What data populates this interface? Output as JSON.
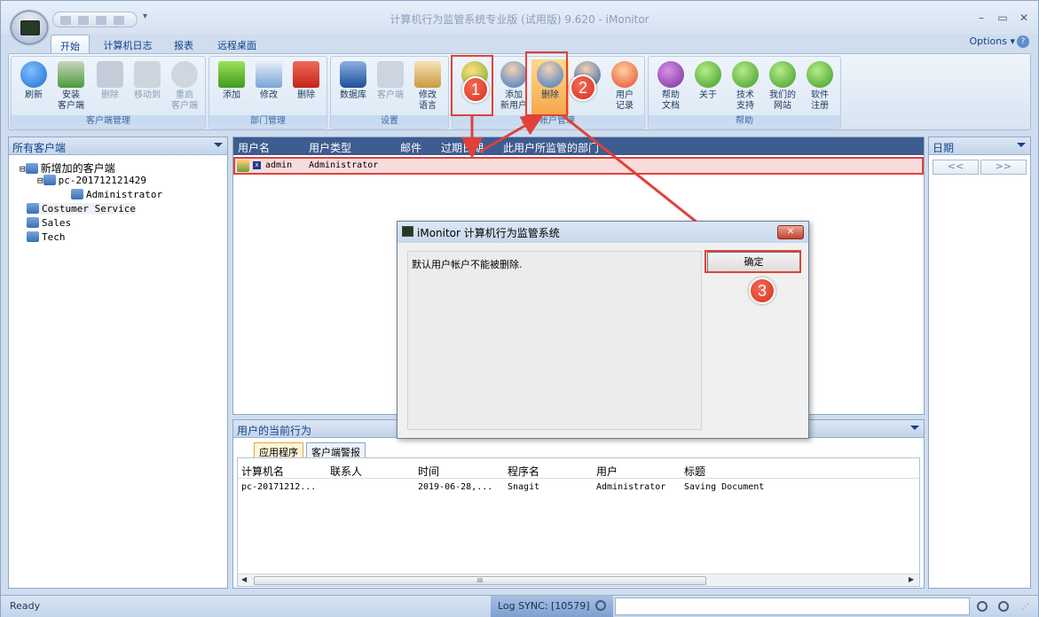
{
  "window": {
    "title": "计算机行为监管系统专业版 (试用版) 9.620 - iMonitor"
  },
  "tabs": [
    "开始",
    "计算机日志",
    "报表",
    "远程桌面"
  ],
  "options_label": "Options",
  "ribbon": {
    "groups": [
      {
        "label": "客户端管理",
        "buttons": [
          "刷新",
          "安装\n客户端",
          "删除",
          "移动到",
          "重启\n客户端"
        ]
      },
      {
        "label": "部门管理",
        "buttons": [
          "添加",
          "修改",
          "删除"
        ]
      },
      {
        "label": "设置",
        "buttons": [
          "数据库",
          "客户端",
          "修改\n语言"
        ]
      },
      {
        "label": "用户帐户管理",
        "buttons": [
          "用户",
          "添加\n新用户",
          "删除",
          "",
          "用户\n记录"
        ]
      },
      {
        "label": "帮助",
        "buttons": [
          "帮助\n文档",
          "关于",
          "技术\n支持",
          "我们的\n网站",
          "软件\n注册"
        ]
      }
    ]
  },
  "left_panel": {
    "title": "所有客户端",
    "tree": [
      "新增加的客户端",
      "pc-201712121429",
      "Administrator",
      "Costumer Service",
      "Sales",
      "Tech"
    ]
  },
  "users_grid": {
    "columns": [
      "用户名",
      "用户类型",
      "邮件",
      "过期日期",
      "此用户所监管的部门"
    ],
    "rows": [
      {
        "name": "admin",
        "type": "Administrator"
      }
    ]
  },
  "right_panel": {
    "title": "日期",
    "prev": "<<",
    "next": ">>"
  },
  "activity": {
    "title": "用户的当前行为",
    "tabs": [
      "应用程序",
      "客户端警报"
    ],
    "columns": [
      "计算机名",
      "联系人",
      "时间",
      "程序名",
      "用户",
      "标题"
    ],
    "rows": [
      [
        "pc-20171212...",
        "",
        "2019-06-28,...",
        "Snagit",
        "Administrator",
        "Saving Document"
      ]
    ],
    "scroll_mark": "III"
  },
  "dialog": {
    "title": "iMonitor 计算机行为监管系统",
    "message": "默认用户帐户不能被删除.",
    "ok_label": "确定"
  },
  "badges": [
    "1",
    "2",
    "3"
  ],
  "status": {
    "left": "Ready",
    "sync": "Log SYNC: [10579]"
  },
  "colors": {
    "accent": "#e0413a",
    "header": "#3d5c8f"
  }
}
